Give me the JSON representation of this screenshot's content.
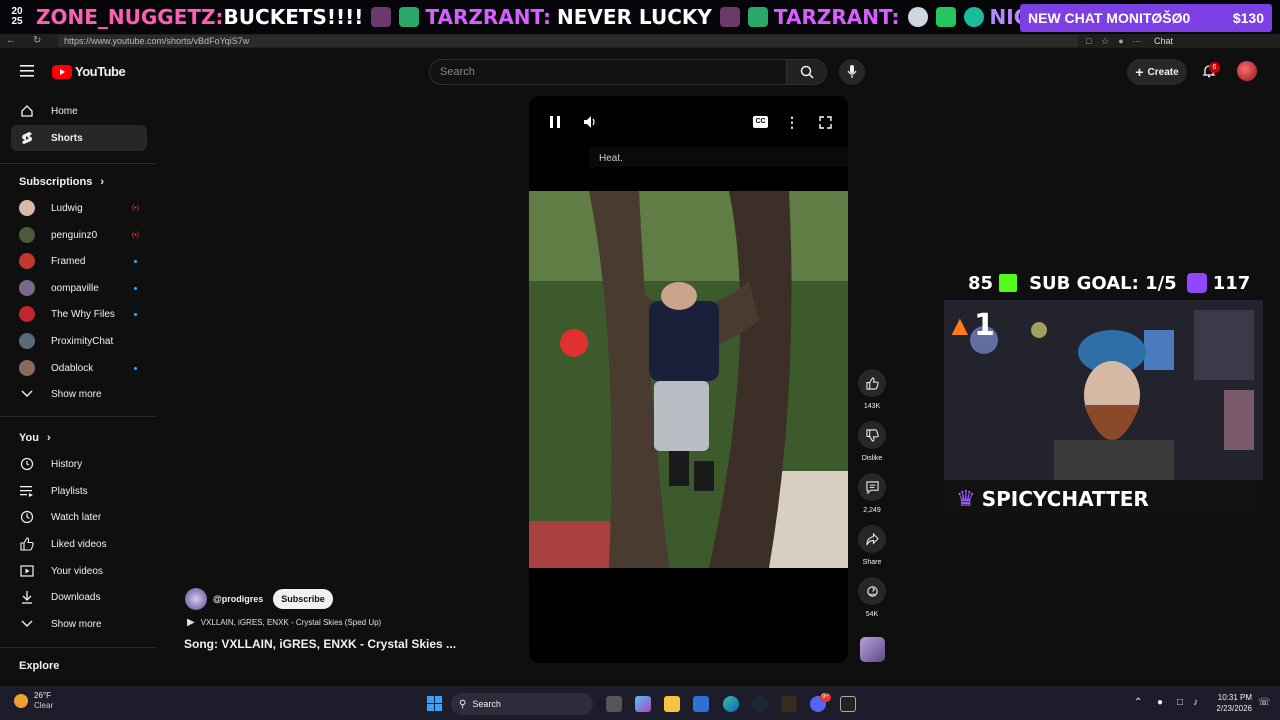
{
  "stream_banner": {
    "year": "20\n25",
    "segments": [
      {
        "text": "ZONE_NUGGETZ:",
        "color": "#ff5fb0"
      },
      {
        "text": "BUCKETS!!!!",
        "color": "#ffffff"
      },
      {
        "text": "TARZRANT:",
        "color": "#d660ff"
      },
      {
        "text": "NEVER LUCKY",
        "color": "#ffffff"
      },
      {
        "text": "TARZRANT:",
        "color": "#d660ff"
      },
      {
        "text": "NIGHTBO",
        "color": "#b48cff"
      }
    ],
    "chat_monitor": {
      "label": "NEW CHAT MONITØŠØ0",
      "amount": "$130"
    }
  },
  "browser": {
    "url": "https://www.youtube.com/shorts/vBdFoYqiS7w",
    "chat_label": "Chat"
  },
  "header": {
    "logo": "YouTube",
    "search_placeholder": "Search",
    "create_label": "Create",
    "notification_count": "6"
  },
  "sidebar": {
    "primary": [
      {
        "label": "Home",
        "icon": "home-icon"
      },
      {
        "label": "Shorts",
        "icon": "shorts-icon",
        "active": true
      }
    ],
    "subscriptions_title": "Subscriptions",
    "subscriptions": [
      {
        "label": "Ludwig",
        "color": "#d9b8a8",
        "status": "live"
      },
      {
        "label": "penguinz0",
        "color": "#4a5a3a",
        "status": "live"
      },
      {
        "label": "Framed",
        "color": "#c0392b",
        "status": "new"
      },
      {
        "label": "oompaville",
        "color": "#7a6a8a",
        "status": "new"
      },
      {
        "label": "The Why Files",
        "color": "#c0262c",
        "status": "new"
      },
      {
        "label": "ProximityChat",
        "color": "#5a6a7a",
        "status": ""
      },
      {
        "label": "Odablock",
        "color": "#8a6a5a",
        "status": "new"
      },
      {
        "label": "Show more",
        "icon": "chevron-down-icon"
      }
    ],
    "you_title": "You",
    "you_items": [
      {
        "label": "History",
        "icon": "history-icon"
      },
      {
        "label": "Playlists",
        "icon": "playlists-icon"
      },
      {
        "label": "Watch later",
        "icon": "watch-later-icon"
      },
      {
        "label": "Liked videos",
        "icon": "liked-icon"
      },
      {
        "label": "Your videos",
        "icon": "your-videos-icon"
      },
      {
        "label": "Downloads",
        "icon": "downloads-icon"
      },
      {
        "label": "Show more",
        "icon": "chevron-down-icon"
      }
    ],
    "explore_title": "Explore",
    "live_marker": "(•)"
  },
  "player": {
    "subtitle": "Heat.",
    "cc_label": "CC"
  },
  "actions": {
    "likes": "143K",
    "dislike": "Dislike",
    "comments": "2,249",
    "share": "Share",
    "remix": "54K"
  },
  "video_info": {
    "channel": "@prodigres",
    "subscribe_label": "Subscribe",
    "song_line": "VXLLAIN, iGRES, ENXK - Crystal Skies (Sped Up)",
    "title": "Song: VXLLAIN, iGRES, ENXK - Crystal Skies ..."
  },
  "stream_overlay": {
    "left_count": "85",
    "goal": "SUB GOAL: 1/5",
    "right_count": "117",
    "streak": "1",
    "chatter": "SPICYCHATTER"
  },
  "taskbar": {
    "temp": "26°F",
    "weather": "Clear",
    "search": "Search",
    "time": "10:31 PM",
    "date": "2/23/2026",
    "discord_badge": "9+"
  }
}
